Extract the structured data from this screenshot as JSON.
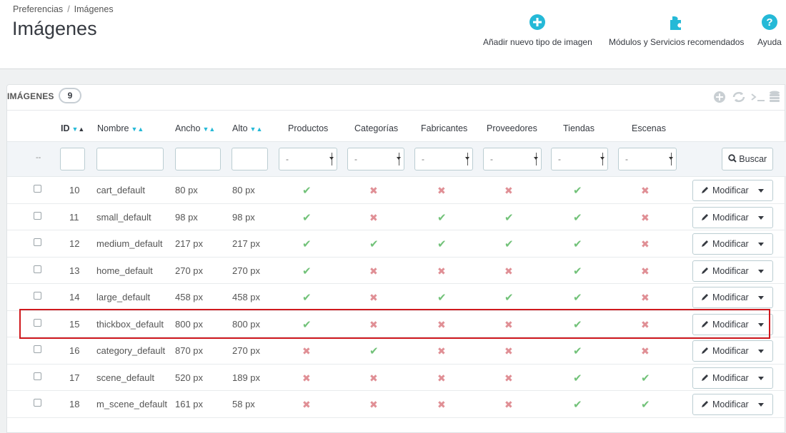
{
  "breadcrumb": {
    "parent": "Preferencias",
    "separator": "/",
    "current": "Imágenes"
  },
  "page_title": "Imágenes",
  "toolbar": {
    "add_label": "Añadir nuevo tipo de imagen",
    "modules_label": "Módulos y Servicios recomendados",
    "help_label": "Ayuda",
    "accent": "#25b9d7"
  },
  "panel": {
    "title": "IMÁGENES",
    "count": "9"
  },
  "columns": {
    "id": "ID",
    "name": "Nombre",
    "width": "Ancho",
    "height": "Alto",
    "products": "Productos",
    "categories": "Categorías",
    "manufacturers": "Fabricantes",
    "suppliers": "Proveedores",
    "stores": "Tiendas",
    "scenes": "Escenas"
  },
  "filters": {
    "bulk_placeholder": "--",
    "select_value": "-",
    "search_label": "Buscar"
  },
  "action_label": "Modificar",
  "rows": [
    {
      "id": "10",
      "name": "cart_default",
      "width": "80 px",
      "height": "80 px",
      "flags": [
        true,
        false,
        false,
        false,
        true,
        false
      ]
    },
    {
      "id": "11",
      "name": "small_default",
      "width": "98 px",
      "height": "98 px",
      "flags": [
        true,
        false,
        true,
        true,
        true,
        false
      ]
    },
    {
      "id": "12",
      "name": "medium_default",
      "width": "217 px",
      "height": "217 px",
      "flags": [
        true,
        true,
        true,
        true,
        true,
        false
      ]
    },
    {
      "id": "13",
      "name": "home_default",
      "width": "270 px",
      "height": "270 px",
      "flags": [
        true,
        false,
        false,
        false,
        true,
        false
      ]
    },
    {
      "id": "14",
      "name": "large_default",
      "width": "458 px",
      "height": "458 px",
      "flags": [
        true,
        false,
        true,
        true,
        true,
        false
      ]
    },
    {
      "id": "15",
      "name": "thickbox_default",
      "width": "800 px",
      "height": "800 px",
      "flags": [
        true,
        false,
        false,
        false,
        true,
        false
      ],
      "highlighted": true
    },
    {
      "id": "16",
      "name": "category_default",
      "width": "870 px",
      "height": "270 px",
      "flags": [
        false,
        true,
        false,
        false,
        true,
        false
      ]
    },
    {
      "id": "17",
      "name": "scene_default",
      "width": "520 px",
      "height": "189 px",
      "flags": [
        false,
        false,
        false,
        false,
        true,
        true
      ]
    },
    {
      "id": "18",
      "name": "m_scene_default",
      "width": "161 px",
      "height": "58 px",
      "flags": [
        false,
        false,
        false,
        false,
        true,
        true
      ]
    }
  ],
  "colors": {
    "check": "#72c279",
    "cross": "#e08f95",
    "highlight": "#d0191e"
  }
}
